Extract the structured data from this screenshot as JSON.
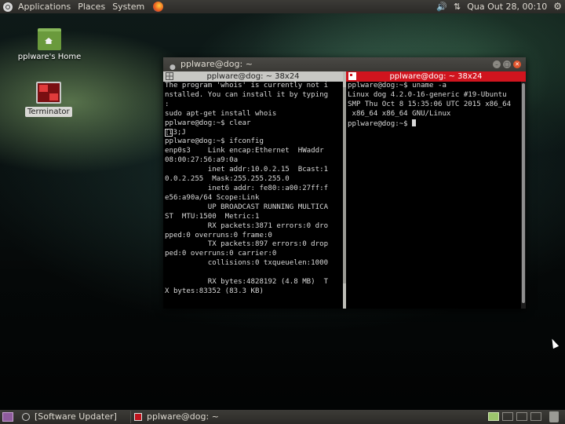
{
  "top_panel": {
    "menus": [
      "Applications",
      "Places",
      "System"
    ],
    "clock": "Qua Out 28, 00:10",
    "icons": [
      "ubuntu-logo-icon",
      "firefox-icon",
      "volume-icon",
      "network-icon",
      "gear-icon"
    ]
  },
  "desktop": {
    "home_label": "pplware's Home",
    "terminator_label": "Terminator"
  },
  "window": {
    "title": "pplware@dog: ~",
    "left_pane": {
      "title": "pplware@dog: ~ 38x24",
      "lines": [
        "The program 'whois' is currently not i",
        "nstalled. You can install it by typing",
        ":",
        "sudo apt-get install whois",
        "pplware@dog:~$ clear",
        "",
        "pplware@dog:~$ ifconfig",
        "enp0s3    Link encap:Ethernet  HWaddr",
        "08:00:27:56:a9:0a",
        "          inet addr:10.0.2.15  Bcast:1",
        "0.0.2.255  Mask:255.255.255.0",
        "          inet6 addr: fe80::a00:27ff:f",
        "e56:a90a/64 Scope:Link",
        "          UP BROADCAST RUNNING MULTICA",
        "ST  MTU:1500  Metric:1",
        "          RX packets:3871 errors:0 dro",
        "pped:0 overruns:0 frame:0",
        "          TX packets:897 errors:0 drop",
        "ped:0 overruns:0 carrier:0",
        "          collisions:0 txqueuelen:1000",
        "",
        "          RX bytes:4828192 (4.8 MB)  T",
        "X bytes:83352 (83.3 KB)"
      ],
      "escape_line_text": "3;J"
    },
    "right_pane": {
      "title": "pplware@dog: ~ 38x24",
      "lines": [
        "pplware@dog:~$ uname -a",
        "Linux dog 4.2.0-16-generic #19-Ubuntu",
        "SMP Thu Oct 8 15:35:06 UTC 2015 x86_64",
        " x86_64 x86_64 GNU/Linux"
      ],
      "prompt": "pplware@dog:~$ "
    }
  },
  "taskbar": {
    "tasks": [
      "[Software Updater]",
      "pplware@dog: ~"
    ]
  },
  "colors": {
    "active_pane_title": "#d0141e",
    "inactive_pane_title": "#c8c8c4",
    "panel_bg": "#3c3b37",
    "workspace_active": "#9cc56c"
  }
}
